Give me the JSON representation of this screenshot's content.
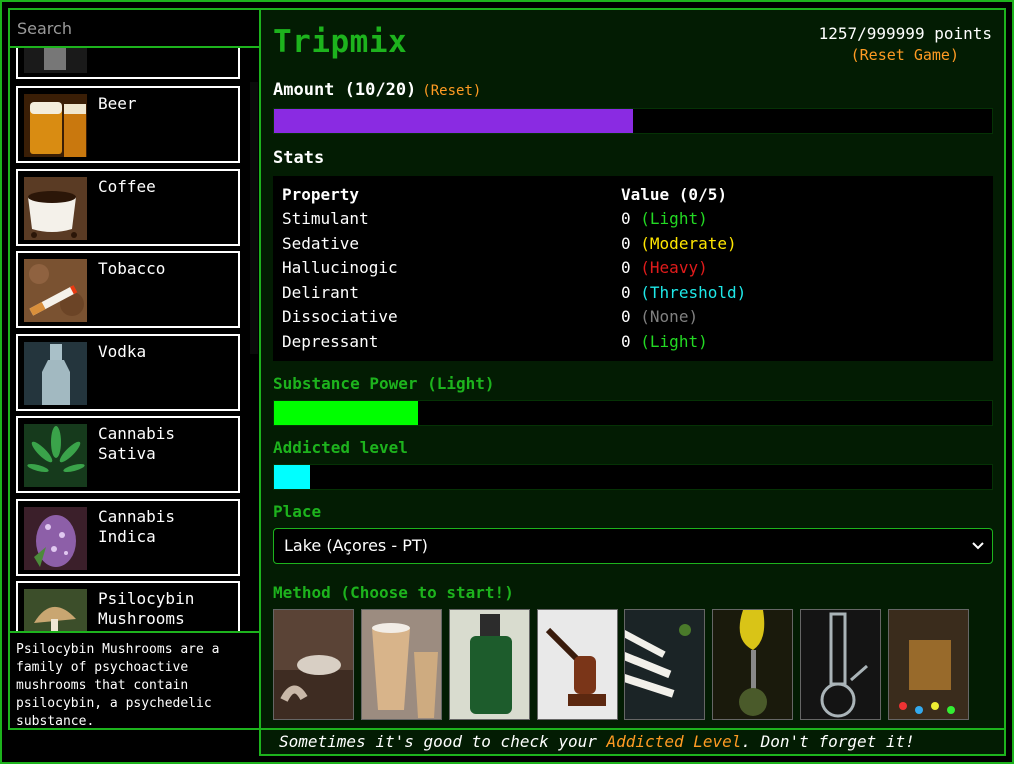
{
  "search": {
    "placeholder": "Search"
  },
  "substances": [
    {
      "label": "Beer"
    },
    {
      "label": "Coffee"
    },
    {
      "label": "Tobacco"
    },
    {
      "label": "Vodka"
    },
    {
      "label": "Cannabis Sativa"
    },
    {
      "label": "Cannabis Indica"
    },
    {
      "label": "Psilocybin Mushrooms"
    }
  ],
  "description": "Psilocybin Mushrooms are a family of psychoactive mushrooms that contain psilocybin, a psychedelic substance.",
  "app": {
    "title": "Tripmix"
  },
  "score": {
    "text": "1257/999999 points",
    "reset_label": "(Reset Game)"
  },
  "amount": {
    "label": "Amount (10/20)",
    "reset_label": "(Reset)",
    "current": 10,
    "max": 20,
    "color": "#8a2be2"
  },
  "stats": {
    "title": "Stats",
    "header_property": "Property",
    "header_value": "Value (0/5)",
    "rows": [
      {
        "property": "Stimulant",
        "value": "0",
        "level": "(Light)",
        "color": "#23d923"
      },
      {
        "property": "Sedative",
        "value": "0",
        "level": "(Moderate)",
        "color": "#ffe600"
      },
      {
        "property": "Hallucinogic",
        "value": "0",
        "level": "(Heavy)",
        "color": "#e01b1b"
      },
      {
        "property": "Delirant",
        "value": "0",
        "level": "(Threshold)",
        "color": "#1ee8e8"
      },
      {
        "property": "Dissociative",
        "value": "0",
        "level": "(None)",
        "color": "#808080"
      },
      {
        "property": "Depressant",
        "value": "0",
        "level": "(Light)",
        "color": "#23d923"
      }
    ]
  },
  "power": {
    "label": "Substance Power (Light)",
    "fraction": 0.2,
    "color": "#00ff00"
  },
  "addicted": {
    "label": "Addicted level",
    "fraction": 0.05,
    "color": "#00ffff"
  },
  "place": {
    "label": "Place",
    "selected": "Lake (Açores - PT)"
  },
  "method": {
    "label": "Method (Choose to start!)",
    "options": [
      {
        "icon": "hand-on-table-icon"
      },
      {
        "icon": "paper-cups-icon"
      },
      {
        "icon": "green-bottle-icon"
      },
      {
        "icon": "smoking-pipe-icon"
      },
      {
        "icon": "joints-icon"
      },
      {
        "icon": "hookah-icon"
      },
      {
        "icon": "glass-bong-icon"
      },
      {
        "icon": "glass-and-pills-icon"
      }
    ]
  },
  "tip": {
    "before": "Sometimes it's good to check your ",
    "highlight": "Addicted Level",
    "after": ". Don't forget it!"
  }
}
